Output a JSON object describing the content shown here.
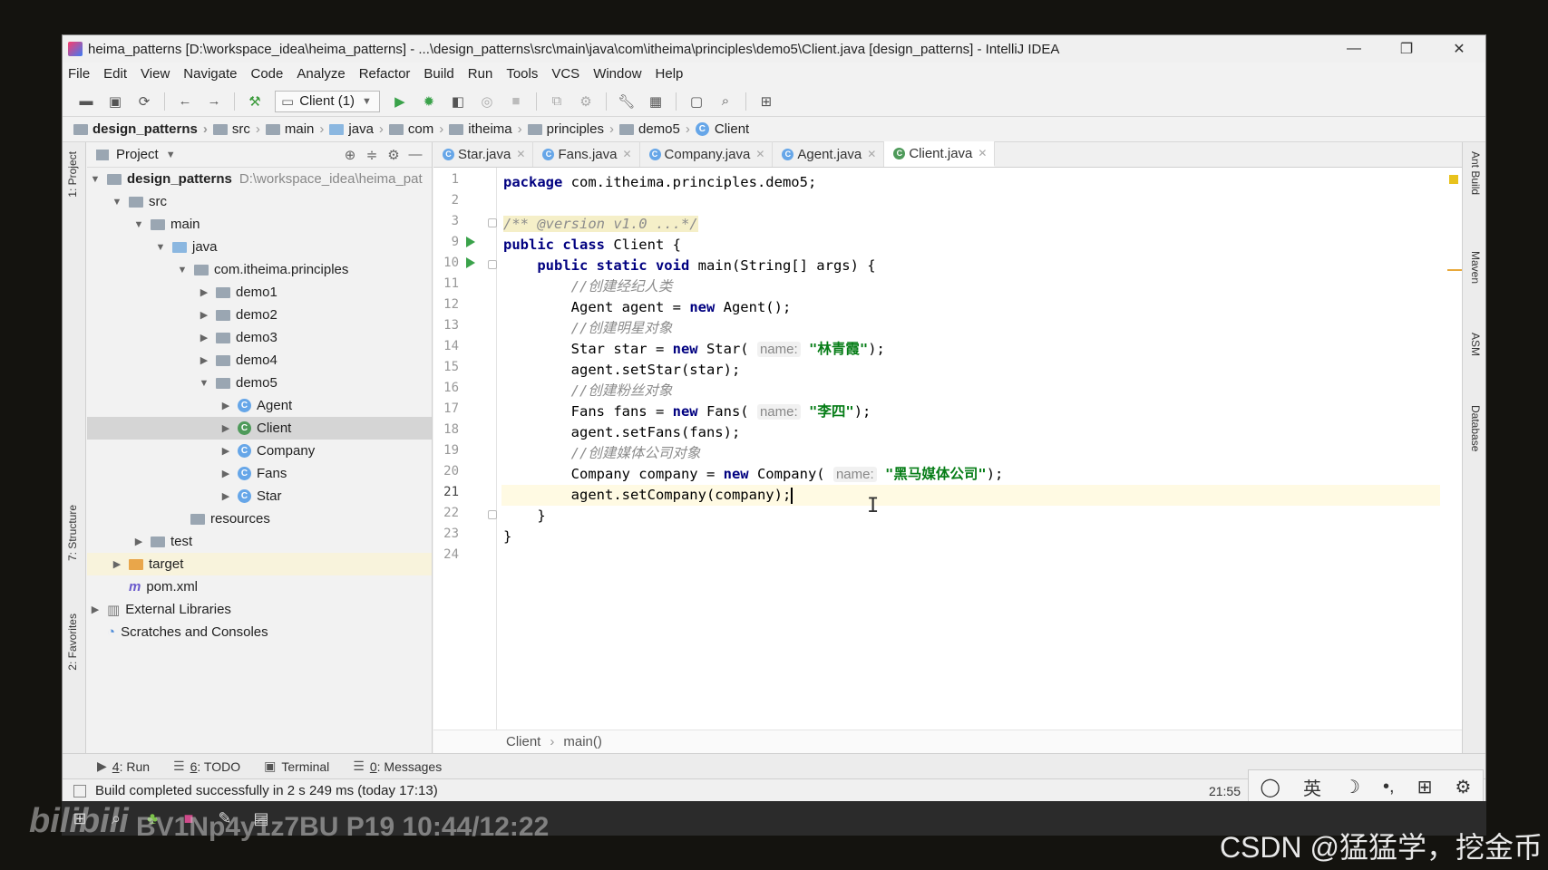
{
  "window": {
    "title": "heima_patterns [D:\\workspace_idea\\heima_patterns] - ...\\design_patterns\\src\\main\\java\\com\\itheima\\principles\\demo5\\Client.java [design_patterns] - IntelliJ IDEA",
    "controls": [
      "—",
      "❐",
      "✕"
    ]
  },
  "menu": [
    "File",
    "Edit",
    "View",
    "Navigate",
    "Code",
    "Analyze",
    "Refactor",
    "Build",
    "Run",
    "Tools",
    "VCS",
    "Window",
    "Help"
  ],
  "toolbar": {
    "run_config": "Client (1)"
  },
  "breadcrumbs": [
    "design_patterns",
    "src",
    "main",
    "java",
    "com",
    "itheima",
    "principles",
    "demo5",
    "Client"
  ],
  "left_tabs": {
    "project": "1: Project",
    "structure": "7: Structure",
    "favorites": "2: Favorites"
  },
  "right_tabs": {
    "ant": "Ant Build",
    "maven": "Maven",
    "asm": "ASM",
    "database": "Database"
  },
  "project": {
    "header": "Project",
    "tree": [
      {
        "label": "design_patterns",
        "path": "D:\\workspace_idea\\heima_pat",
        "level": 0
      },
      {
        "label": "src",
        "level": 1
      },
      {
        "label": "main",
        "level": 2
      },
      {
        "label": "java",
        "level": 3
      },
      {
        "label": "com.itheima.principles",
        "level": 4
      },
      {
        "label": "demo1",
        "level": 5
      },
      {
        "label": "demo2",
        "level": 5
      },
      {
        "label": "demo3",
        "level": 5
      },
      {
        "label": "demo4",
        "level": 5
      },
      {
        "label": "demo5",
        "level": 5
      },
      {
        "label": "Agent",
        "level": 6
      },
      {
        "label": "Client",
        "level": 6
      },
      {
        "label": "Company",
        "level": 6
      },
      {
        "label": "Fans",
        "level": 6
      },
      {
        "label": "Star",
        "level": 6
      },
      {
        "label": "resources",
        "level": 3
      },
      {
        "label": "test",
        "level": 2
      },
      {
        "label": "target",
        "level": 1
      },
      {
        "label": "pom.xml",
        "level": 1
      },
      {
        "label": "External Libraries",
        "level": 0
      },
      {
        "label": "Scratches and Consoles",
        "level": 0
      }
    ]
  },
  "editor": {
    "tabs": [
      "Star.java",
      "Fans.java",
      "Company.java",
      "Agent.java",
      "Client.java"
    ],
    "active_tab": "Client.java",
    "line_numbers": [
      "1",
      "2",
      "3",
      "9",
      "10",
      "11",
      "12",
      "13",
      "14",
      "15",
      "16",
      "17",
      "18",
      "19",
      "20",
      "21",
      "22",
      "23",
      "24"
    ],
    "code": {
      "l1_kw": "package",
      "l1_rest": " com.itheima.principles.demo5;",
      "l3": "/** @version v1.0 ...*/",
      "l9_kw": "public class",
      "l9_rest": " Client {",
      "l10_kw": "public static void",
      "l10_rest": " main(String[] args) {",
      "l11": "//创建经纪人类",
      "l12_a": "Agent agent = ",
      "l12_kw": "new",
      "l12_b": " Agent();",
      "l13": "//创建明星对象",
      "l14_a": "Star star = ",
      "l14_kw": "new",
      "l14_b": " Star( ",
      "l14_hint": "name:",
      "l14_str": "\"林青霞\"",
      "l14_c": ");",
      "l15": "agent.setStar(star);",
      "l16": "//创建粉丝对象",
      "l17_a": "Fans fans = ",
      "l17_kw": "new",
      "l17_b": " Fans( ",
      "l17_hint": "name:",
      "l17_str": "\"李四\"",
      "l17_c": ");",
      "l18": "agent.setFans(fans);",
      "l19": "//创建媒体公司对象",
      "l20_a": "Company company = ",
      "l20_kw": "new",
      "l20_b": " Company( ",
      "l20_hint": "name:",
      "l20_str": "\"黑马媒体公司\"",
      "l20_c": ");",
      "l21": "agent.setCompany(company);",
      "l22": "}",
      "l23": "}"
    },
    "crumb": [
      "Client",
      "main()"
    ]
  },
  "bottom_tabs": [
    {
      "num": "4",
      "label": ": Run"
    },
    {
      "num": "6",
      "label": ": TODO"
    },
    {
      "num": "",
      "label": "Terminal"
    },
    {
      "num": "0",
      "label": ": Messages"
    }
  ],
  "status": {
    "message": "Build completed successfully in 2 s 249 ms (today 17:13)",
    "position": "21:55"
  },
  "ime": [
    "◯",
    "英",
    "☽",
    "•,",
    "⊞",
    "⚙"
  ],
  "overlay": {
    "bili": "bilibili",
    "bv": "BV1Np4y1z7BU P19 10:44/12:22",
    "csdn": "CSDN @猛猛学，挖金币"
  },
  "colors": {
    "keyword": "#000080",
    "string": "#067d17",
    "comment": "#8c8c8c",
    "current_line": "#fffae3"
  }
}
